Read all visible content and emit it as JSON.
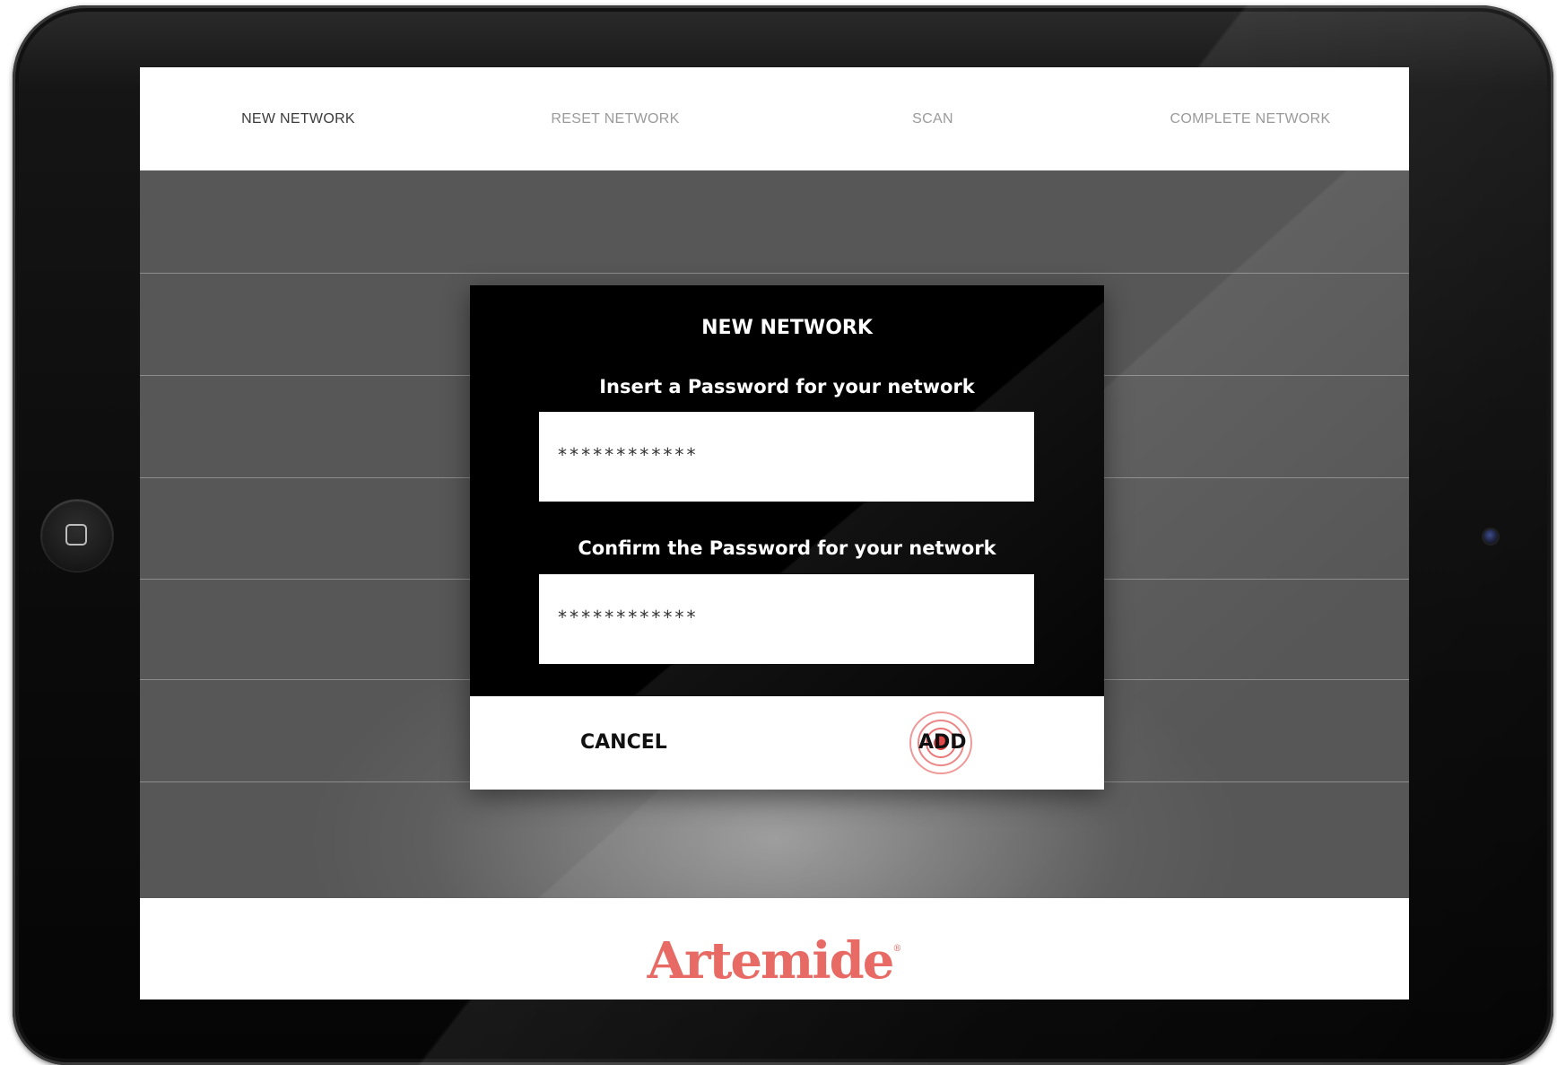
{
  "device": {
    "home_button_icon": "home-square-icon",
    "camera_icon": "front-camera-icon"
  },
  "nav": {
    "tabs": [
      {
        "label": "NEW NETWORK",
        "active": true
      },
      {
        "label": "RESET NETWORK",
        "active": false
      },
      {
        "label": "SCAN",
        "active": false
      },
      {
        "label": "COMPLETE NETWORK",
        "active": false
      }
    ]
  },
  "dialog": {
    "title": "NEW NETWORK",
    "password_label": "Insert a Password for your network",
    "password_value": "************",
    "confirm_label": "Confirm the Password for your network",
    "confirm_value": "************",
    "cancel_label": "CANCEL",
    "add_label": "ADD"
  },
  "footer": {
    "brand": "Artemide",
    "brand_mark": "®"
  },
  "colors": {
    "brand": "#e86a64",
    "tap_indicator": "#e04646",
    "dialog_background": "#000000",
    "content_background": "#5a5a5a"
  }
}
